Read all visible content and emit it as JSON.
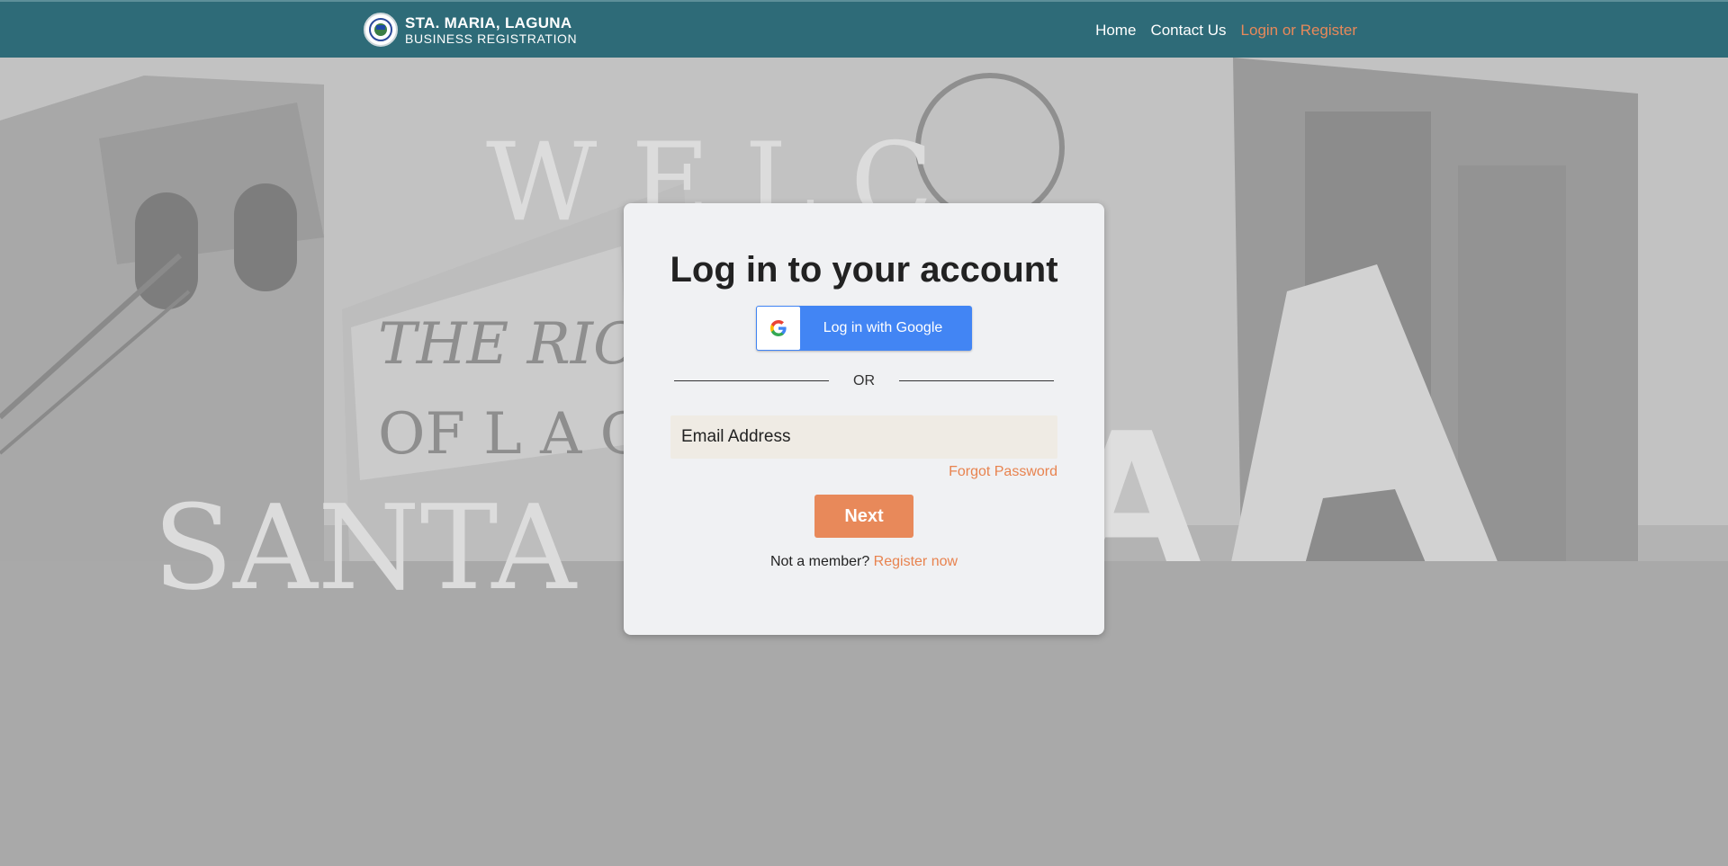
{
  "header": {
    "title": "STA. MARIA, LAGUNA",
    "subtitle": "BUSINESS REGISTRATION",
    "nav": [
      {
        "label": "Home"
      },
      {
        "label": "Contact Us"
      },
      {
        "label": "Login or Register"
      }
    ]
  },
  "background": {
    "sign_words": [
      "W E L C",
      "THE RICE",
      "OF L A G",
      "SANTA",
      "A"
    ]
  },
  "login": {
    "title": "Log in to your account",
    "google_label": "Log in with Google",
    "or_text": "OR",
    "email_placeholder": "Email Address",
    "forgot_label": "Forgot Password",
    "next_label": "Next",
    "member_text": "Not a member?",
    "register_label": "Register now"
  },
  "colors": {
    "navbar": "#2e6b78",
    "accent": "#e8895a",
    "google_blue": "#4285f4",
    "card": "#f0f1f3"
  },
  "icons": [
    "municipal-seal-icon",
    "google-g-icon"
  ]
}
